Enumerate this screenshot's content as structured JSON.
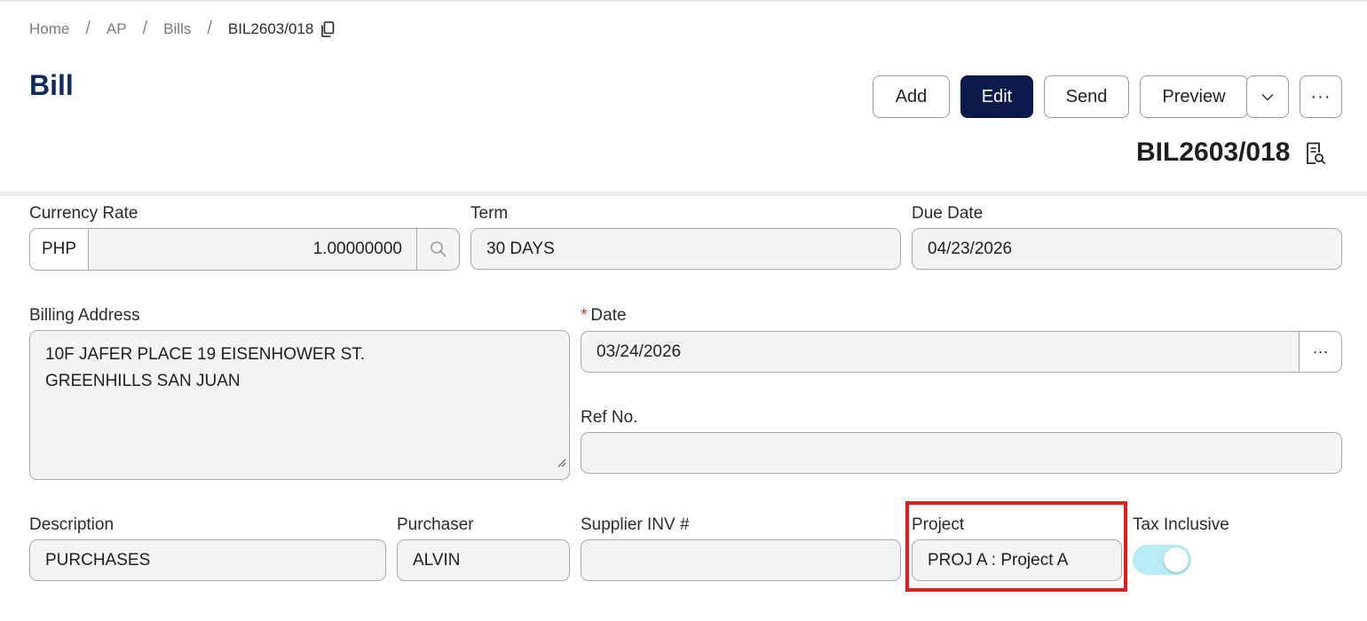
{
  "breadcrumb": {
    "items": [
      "Home",
      "AP",
      "Bills"
    ],
    "current": "BIL2603/018",
    "separator": "/"
  },
  "header": {
    "title": "Bill",
    "doc_number": "BIL2603/018"
  },
  "toolbar": {
    "add_label": "Add",
    "edit_label": "Edit",
    "send_label": "Send",
    "preview_label": "Preview",
    "more_label": "···"
  },
  "form": {
    "currency_rate": {
      "label": "Currency Rate",
      "currency": "PHP",
      "rate": "1.00000000"
    },
    "term": {
      "label": "Term",
      "value": "30 DAYS"
    },
    "due_date": {
      "label": "Due Date",
      "value": "04/23/2026"
    },
    "billing_address": {
      "label": "Billing Address",
      "line1": "10F JAFER PLACE 19 EISENHOWER ST.",
      "line2": "GREENHILLS SAN JUAN"
    },
    "date": {
      "label": "Date",
      "required_mark": "*",
      "value": "03/24/2026"
    },
    "ref_no": {
      "label": "Ref No.",
      "value": ""
    },
    "description": {
      "label": "Description",
      "value": "PURCHASES"
    },
    "purchaser": {
      "label": "Purchaser",
      "value": "ALVIN"
    },
    "supplier_inv": {
      "label": "Supplier INV #",
      "value": ""
    },
    "project": {
      "label": "Project",
      "value": "PROJ A : Project A"
    },
    "tax_inclusive": {
      "label": "Tax Inclusive",
      "enabled": true
    }
  },
  "colors": {
    "primary": "#0c1a4b",
    "title": "#0f2a5f",
    "highlight": "#e02020",
    "toggle_on": "#b8ecf7",
    "required": "#d9342b"
  },
  "icons": {
    "copy": "copy-icon",
    "search": "search-icon",
    "caret": "chevron-down-icon",
    "document": "document-search-icon"
  }
}
